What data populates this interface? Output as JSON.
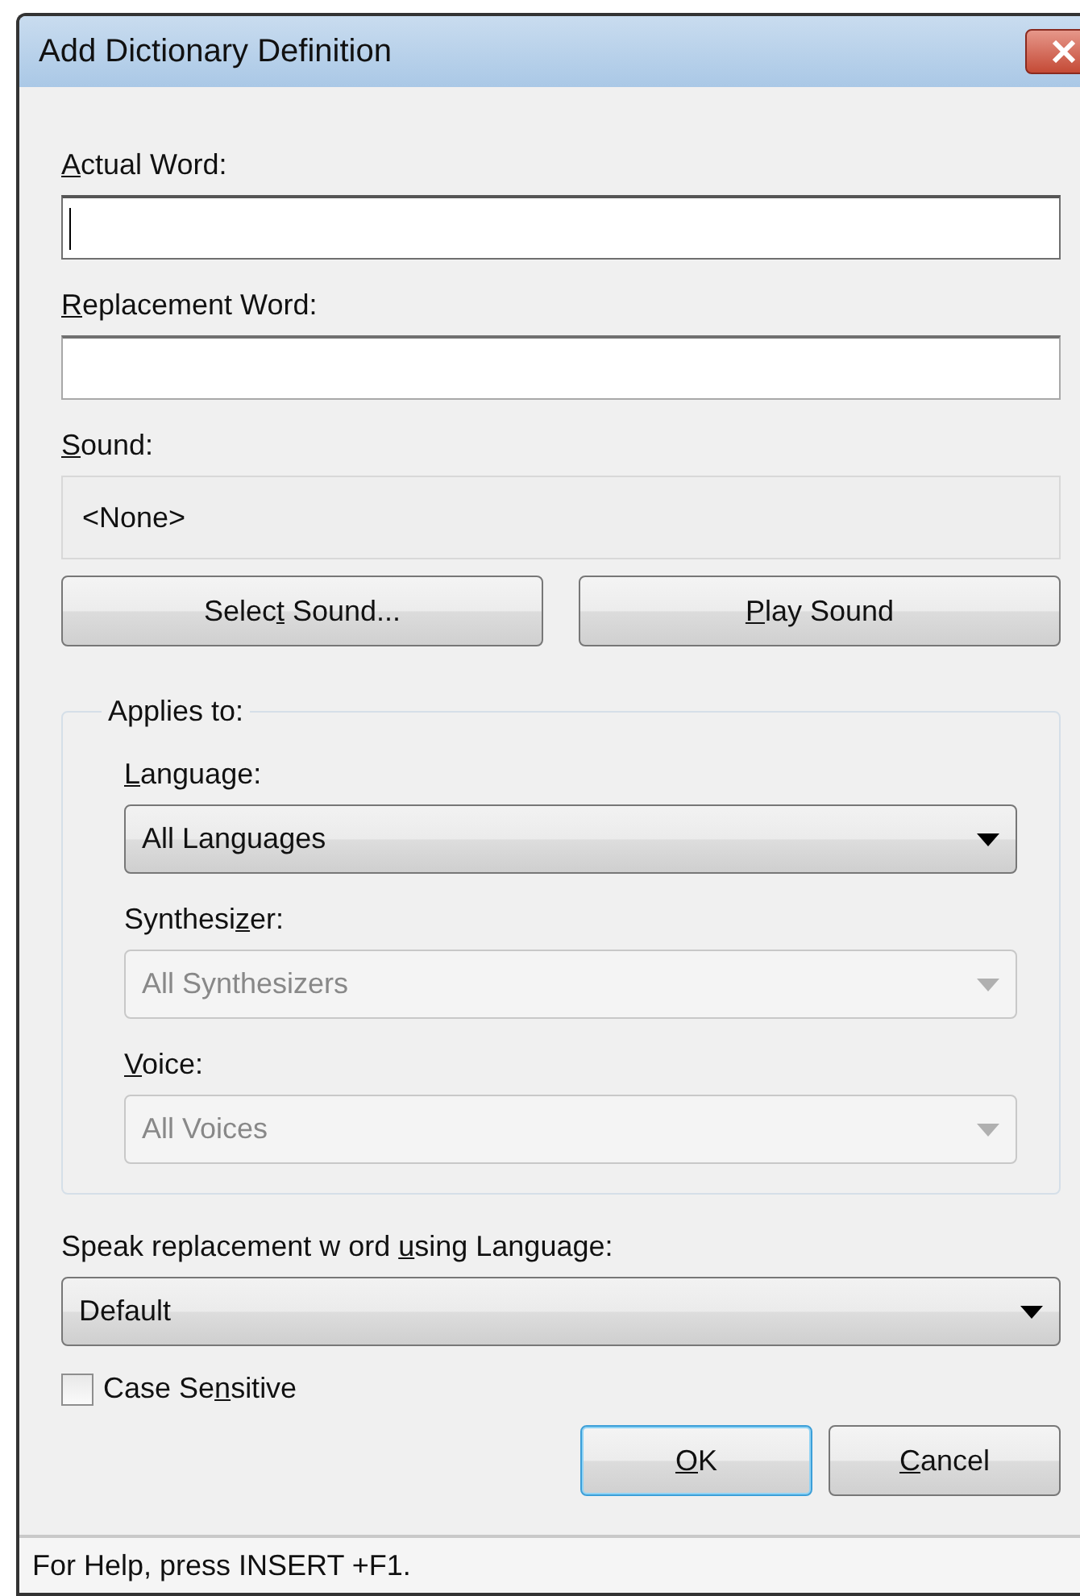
{
  "window": {
    "title": "Add Dictionary Definition"
  },
  "fields": [
    {
      "label": {
        "key": "A",
        "post": "ctual Word:"
      },
      "focused": true
    },
    {
      "label": {
        "key": "R",
        "post": "eplacement Word:"
      },
      "focused": false
    }
  ],
  "sound": {
    "label": {
      "key": "S",
      "post": "ound:"
    },
    "value": "<None>"
  },
  "sound_buttons": [
    {
      "label": {
        "pre": "Selec",
        "key": "t",
        "post": " Sound..."
      },
      "default": false
    },
    {
      "label": {
        "key": "P",
        "post": "lay Sound"
      },
      "default": false
    }
  ],
  "applies_to": {
    "title": "Applies to:",
    "dropdowns": [
      {
        "label": {
          "key": "L",
          "post": "anguage:"
        },
        "value": "All Languages",
        "disabled": false
      },
      {
        "label": {
          "pre": "Synthesi",
          "key": "z",
          "post": "er:"
        },
        "value": "All Synthesizers",
        "disabled": true
      },
      {
        "label": {
          "key": "V",
          "post": "oice:"
        },
        "value": "All Voices",
        "disabled": true
      }
    ]
  },
  "speak_language": {
    "label": {
      "pre": "Speak replacement w ord ",
      "key": "u",
      "post": "sing Language:"
    },
    "value": "Default",
    "disabled": false
  },
  "case_sensitive": {
    "label": {
      "pre": "Case Se",
      "key": "n",
      "post": "sitive"
    },
    "checked": false
  },
  "buttons": [
    {
      "label": {
        "key": "O",
        "post": "K"
      },
      "default": true
    },
    {
      "label": {
        "key": "C",
        "post": "ancel"
      },
      "default": false
    }
  ],
  "status_bar": "For Help, press INSERT +F1."
}
